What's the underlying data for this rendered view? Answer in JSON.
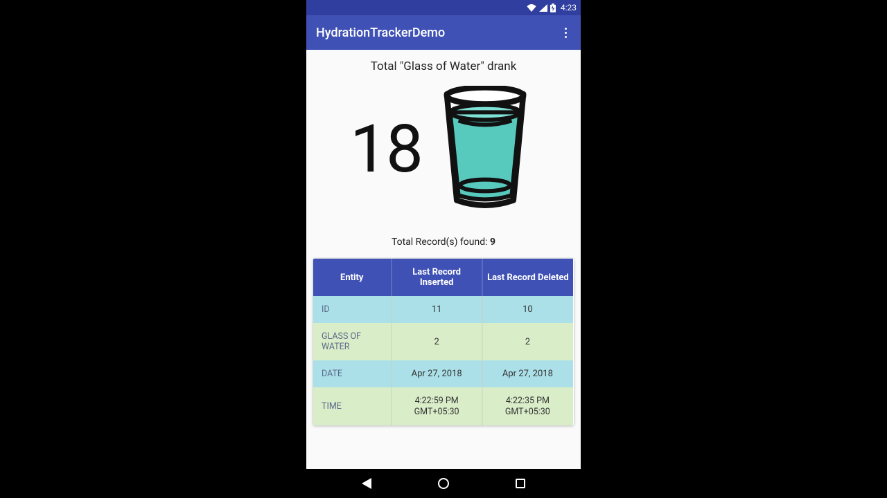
{
  "status": {
    "clock": "4:23"
  },
  "appbar": {
    "title": "HydrationTrackerDemo"
  },
  "main": {
    "heading": "Total \"Glass of Water\" drank",
    "count": "18",
    "records_label": "Total Record(s) found: ",
    "records_count": "9"
  },
  "table": {
    "headers": {
      "entity": "Entity",
      "inserted": "Last Record Inserted",
      "deleted": "Last Record Deleted"
    },
    "rows": [
      {
        "entity": "ID",
        "inserted": "11",
        "deleted": "10"
      },
      {
        "entity": "GLASS OF WATER",
        "inserted": "2",
        "deleted": "2"
      },
      {
        "entity": "DATE",
        "inserted": "Apr 27, 2018",
        "deleted": "Apr 27, 2018"
      },
      {
        "entity": "TIME",
        "inserted_l1": "4:22:59 PM",
        "inserted_l2": "GMT+05:30",
        "deleted_l1": "4:22:35 PM",
        "deleted_l2": "GMT+05:30"
      }
    ]
  }
}
